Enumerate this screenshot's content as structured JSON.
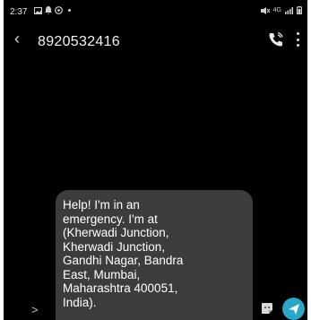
{
  "status_bar": {
    "time": "2:37",
    "left_icons": [
      "image-icon",
      "notification-icon",
      "whatsapp-icon",
      "dot-icon"
    ],
    "right_icons": [
      "mute-icon",
      "network-icon",
      "signal-icon",
      "battery-icon"
    ],
    "network_text": "4G"
  },
  "header": {
    "contact_number": "8920532416",
    "back_icon": "chevron-left-icon",
    "call_icon": "phone-call-icon",
    "more_icon": "more-vertical-icon"
  },
  "message": {
    "text": "Help! I'm in an\nemergency. I'm at\n(Kherwadi Junction,\nKherwadi Junction,\nGandhi Nagar, Bandra\nEast, Mumbai,\nMaharashtra 400051,\nIndia)."
  },
  "composer": {
    "expand_icon": "chevron-right-icon",
    "sticker_icon": "sticker-icon",
    "send_icon": "send-icon",
    "send_color": "#2aa6c8"
  }
}
